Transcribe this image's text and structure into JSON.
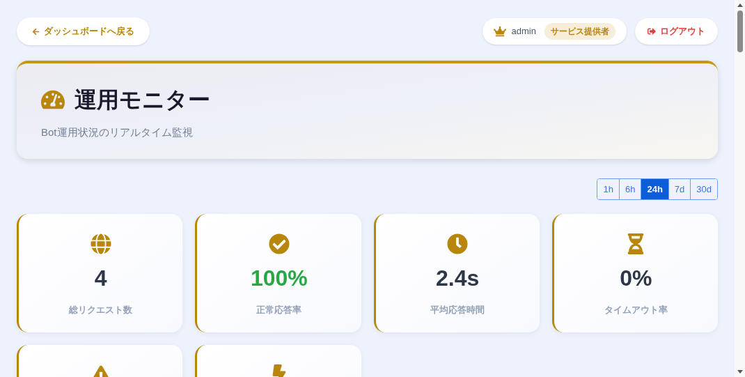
{
  "top_bar": {
    "back_button": "ダッシュボードへ戻る",
    "user": {
      "name": "admin",
      "role_badge": "サービス提供者"
    },
    "logout_button": "ログアウト"
  },
  "header": {
    "title": "運用モニター",
    "subtitle": "Bot運用状況のリアルタイム監視"
  },
  "range_tabs": [
    {
      "label": "1h",
      "selected": false
    },
    {
      "label": "6h",
      "selected": false
    },
    {
      "label": "24h",
      "selected": true
    },
    {
      "label": "7d",
      "selected": false
    },
    {
      "label": "30d",
      "selected": false
    }
  ],
  "stats": [
    {
      "kind": "globe",
      "value": "4",
      "label": "総リクエスト数",
      "color": "#2d3748"
    },
    {
      "kind": "check",
      "value": "100%",
      "label": "正常応答率",
      "color": "#28a745"
    },
    {
      "kind": "clock",
      "value": "2.4s",
      "label": "平均応答時間",
      "color": "#2d3748"
    },
    {
      "kind": "hourglass",
      "value": "0%",
      "label": "タイムアウト率",
      "color": "#2d3748"
    },
    {
      "kind": "warning"
    },
    {
      "kind": "bolt"
    }
  ]
}
